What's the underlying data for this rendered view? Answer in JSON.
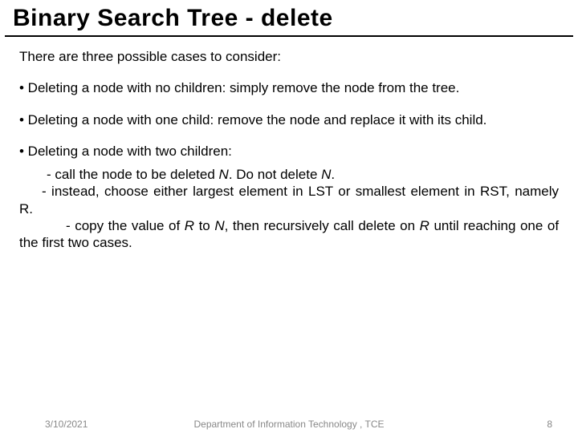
{
  "title": "Binary Search Tree - delete",
  "intro": "There are three possible cases to consider:",
  "bullets": {
    "b1": "•  Deleting a node with no children: simply remove the node from the tree.",
    "b2": "•  Deleting a node with one child: remove the node and replace it with its child.",
    "b3": "•  Deleting a node with two children:"
  },
  "sub": {
    "s1a": "- call the node to be deleted ",
    "s1b": "N",
    "s1c": ". Do not delete ",
    "s1d": "N",
    "s1e": ".",
    "s2": "- instead, choose either largest element in LST or smallest element in RST, namely R.",
    "s3a": "-  copy  the  value  of ",
    "s3b": " R ",
    "s3c": " to ",
    "s3d": " N",
    "s3e": ",  then  recursively  call  delete  on ",
    "s3f": " R ",
    "s3g": " until reaching one of the first two cases."
  },
  "footer": {
    "date": "3/10/2021",
    "dept": "Department of Information Technology , TCE",
    "page": "8"
  }
}
